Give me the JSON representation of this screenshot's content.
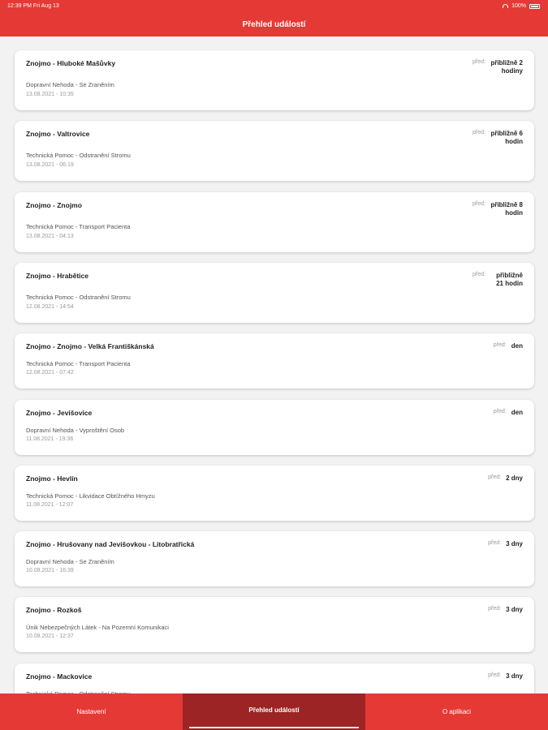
{
  "status_bar": {
    "time_date": "12:39 PM  Fri Aug 13",
    "battery": "100%"
  },
  "header": {
    "title": "Přehled událostí"
  },
  "ago_prefix": "před:",
  "events": [
    {
      "place": "Znojmo - Hluboké Mašůvky",
      "type": "Dopravní Nehoda - Se Zraněním",
      "datetime": "13.08.2021 - 10:35",
      "ago": "přibližně 2 hodiny"
    },
    {
      "place": "Znojmo - Valtrovice",
      "type": "Technická Pomoc - Odstranění Stromu",
      "datetime": "13.08.2021 - 06:19",
      "ago": "přibližně 6 hodin"
    },
    {
      "place": "Znojmo - Znojmo",
      "type": "Technická Pomoc - Transport Pacienta",
      "datetime": "13.08.2021 - 04:13",
      "ago": "přibližně 8 hodin"
    },
    {
      "place": "Znojmo - Hrabětice",
      "type": "Technická Pomoc - Odstranění Stromu",
      "datetime": "12.08.2021 - 14:54",
      "ago": "přibližně 21 hodin"
    },
    {
      "place": "Znojmo - Znojmo - Velká Františkánská",
      "type": "Technická Pomoc - Transport Pacienta",
      "datetime": "12.08.2021 - 07:42",
      "ago": "den"
    },
    {
      "place": "Znojmo - Jevišovice",
      "type": "Dopravní Nehoda - Vyproštění Osob",
      "datetime": "11.08.2021 - 19:36",
      "ago": "den"
    },
    {
      "place": "Znojmo - Hevlín",
      "type": "Technická Pomoc - Likvidace Obtížného Hmyzu",
      "datetime": "11.08.2021 - 12:07",
      "ago": "2 dny"
    },
    {
      "place": "Znojmo - Hrušovany nad Jevišovkou - Litobratřická",
      "type": "Dopravní Nehoda - Se Zraněním",
      "datetime": "10.08.2021 - 16:39",
      "ago": "3 dny"
    },
    {
      "place": "Znojmo - Rozkoš",
      "type": "Únik Nebezpečných Látek - Na Pozemní Komunikaci",
      "datetime": "10.08.2021 - 12:37",
      "ago": "3 dny"
    },
    {
      "place": "Znojmo - Mackovice",
      "type": "Technická Pomoc - Odstranění Stromu",
      "datetime": "",
      "ago": "3 dny"
    }
  ],
  "tabs": [
    {
      "label": "Nastavení",
      "active": false
    },
    {
      "label": "Přehled událostí",
      "active": true
    },
    {
      "label": "O aplikaci",
      "active": false
    }
  ],
  "colors": {
    "primary": "#e53935",
    "active_tab": "#9c2424",
    "background": "#f2f2f2"
  }
}
